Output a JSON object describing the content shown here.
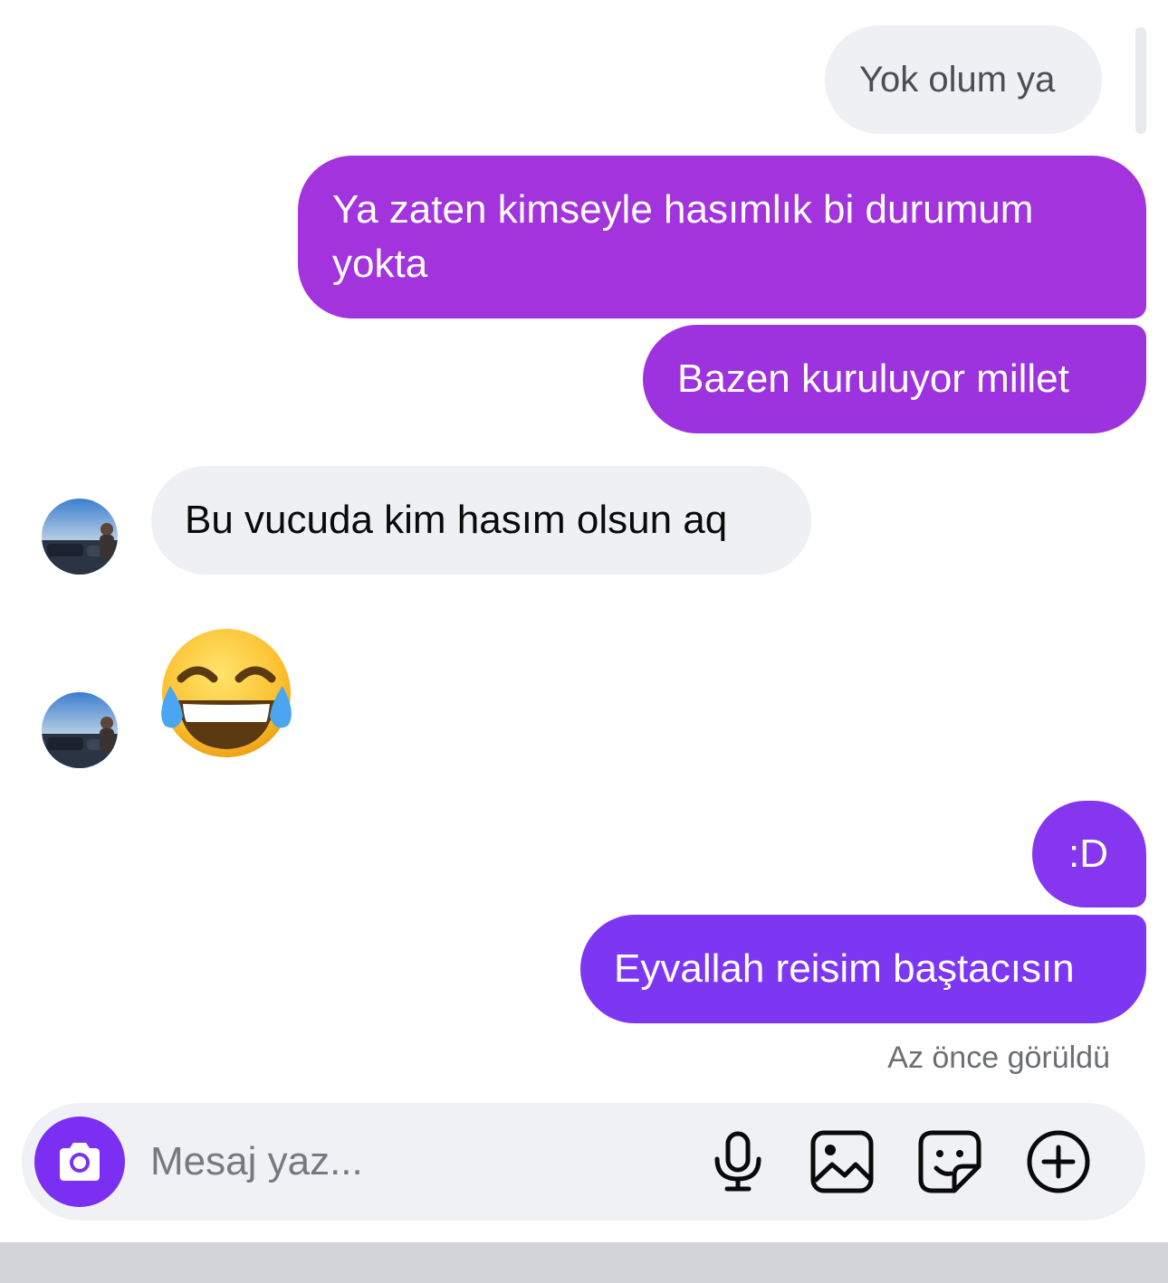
{
  "messages": [
    {
      "text": "Yok olum ya"
    },
    {
      "text_line1": "Ya zaten kimseyle hasımlık bi durumum",
      "text_line2": "yokta"
    },
    {
      "text": "Bazen kuruluyor millet"
    },
    {
      "text": "Bu vucuda kim hasım olsun aq"
    },
    {
      "emoji": "😂",
      "emoji_name": "face-with-tears-of-joy"
    },
    {
      "text": ":D"
    },
    {
      "text": "Eyvallah reisim baştacısın"
    }
  ],
  "status": {
    "seen": "Az önce görüldü"
  },
  "composer": {
    "placeholder": "Mesaj yaz...",
    "icons": [
      "camera-icon",
      "microphone-icon",
      "image-icon",
      "sticker-icon",
      "plus-icon"
    ]
  },
  "colors": {
    "accent": "#7b2ff2",
    "bubble_out_top": "#a534d9",
    "bubble_out_bottom": "#8035f0",
    "bubble_in": "#eef0f3",
    "seen_text": "#6b6e73"
  }
}
